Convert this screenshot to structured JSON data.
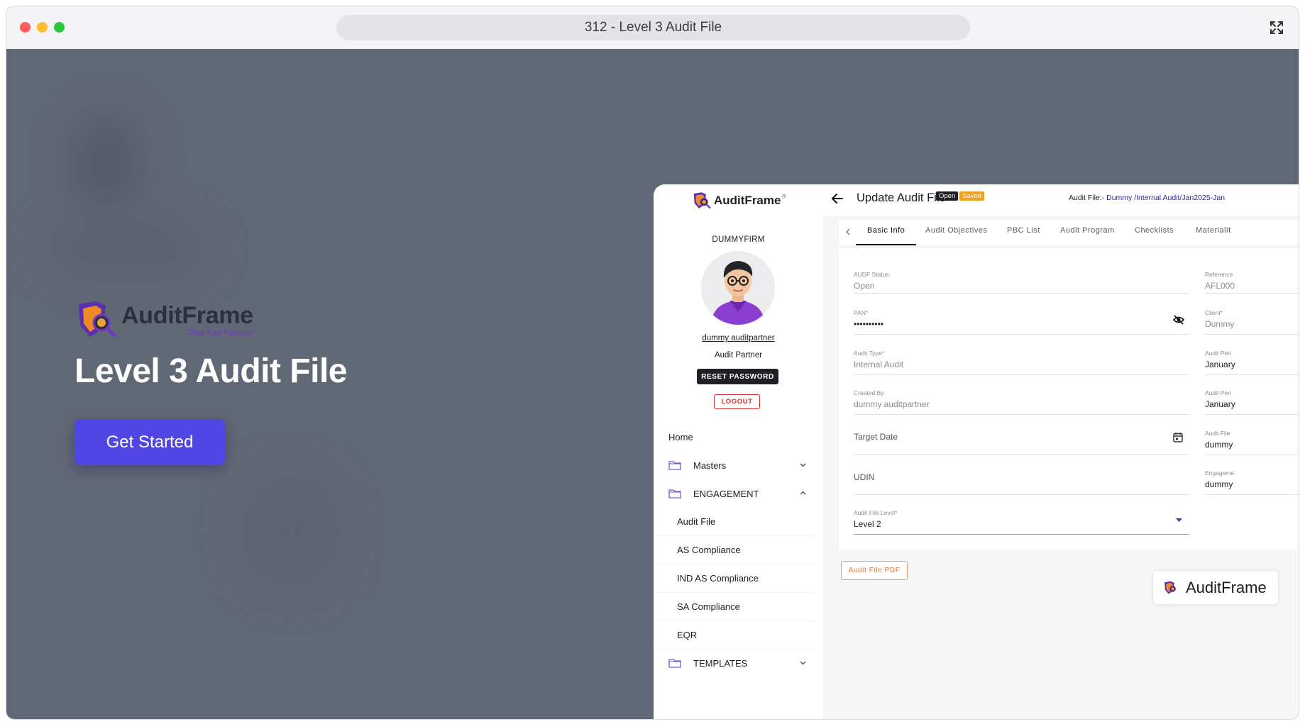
{
  "browser": {
    "address": "312 - Level 3 Audit File"
  },
  "hero": {
    "brand": "AuditFrame",
    "tagline": "True Fair Forever",
    "title": "Level 3 Audit File",
    "cta": "Get Started"
  },
  "sidebar": {
    "brand": "AuditFrame",
    "brand_mark": "®",
    "firm": "DUMMYFIRM",
    "user_name": "dummy auditpartner",
    "user_role": "Audit Partner",
    "reset_label": "RESET PASSWORD",
    "logout_label": "LOGOUT",
    "nav": {
      "home": "Home",
      "masters": "Masters",
      "engagement": "ENGAGEMENT",
      "audit_file": "Audit File",
      "as_compliance": "AS Compliance",
      "ind_as_compliance": "IND AS Compliance",
      "sa_compliance": "SA Compliance",
      "eqr": "EQR",
      "templates": "TEMPLATES"
    }
  },
  "header": {
    "title": "Update Audit File",
    "badge_open": "Open",
    "badge_saved": "Saved",
    "path_prefix": "Audit File:- ",
    "path_link": "Dummy /Internal Audit/Jan2025-Jan"
  },
  "tabs": [
    "Basic Info",
    "Audit Objectives",
    "PBC List",
    "Audit Program",
    "Checklists",
    "Materialit"
  ],
  "form": {
    "left": {
      "audf_status": {
        "label": "AUDF Status",
        "value": "Open"
      },
      "pan": {
        "label": "PAN*",
        "value": "••••••••••"
      },
      "audit_type": {
        "label": "Audit Type*",
        "value": "Internal Audit"
      },
      "created_by": {
        "label": "Created By",
        "value": "dummy auditpartner"
      },
      "target_date": {
        "placeholder": "Target Date"
      },
      "udin": {
        "placeholder": "UDIN"
      },
      "level": {
        "label": "Audit File Level*",
        "value": "Level 2"
      }
    },
    "right": {
      "reference": {
        "label": "Reference",
        "value": "AFL000"
      },
      "client": {
        "label": "Client*",
        "value": "Dummy"
      },
      "period_from": {
        "label": "Audit Peri",
        "value": "January"
      },
      "period_to": {
        "label": "Audit Peri",
        "value": "January"
      },
      "audit_file": {
        "label": "Audit File",
        "value": "dummy"
      },
      "engagement": {
        "label": "Engageme",
        "value": "dummy"
      }
    }
  },
  "pdf_button": "Audit File PDF",
  "footer_chip": "AuditFrame",
  "colors": {
    "backdrop": "#616875",
    "cta": "#4f46e5",
    "brand_purple": "#6f38c5",
    "logout_red": "#d22b2b",
    "saved_orange": "#f0a020",
    "pdf_orange": "#e8722a"
  }
}
